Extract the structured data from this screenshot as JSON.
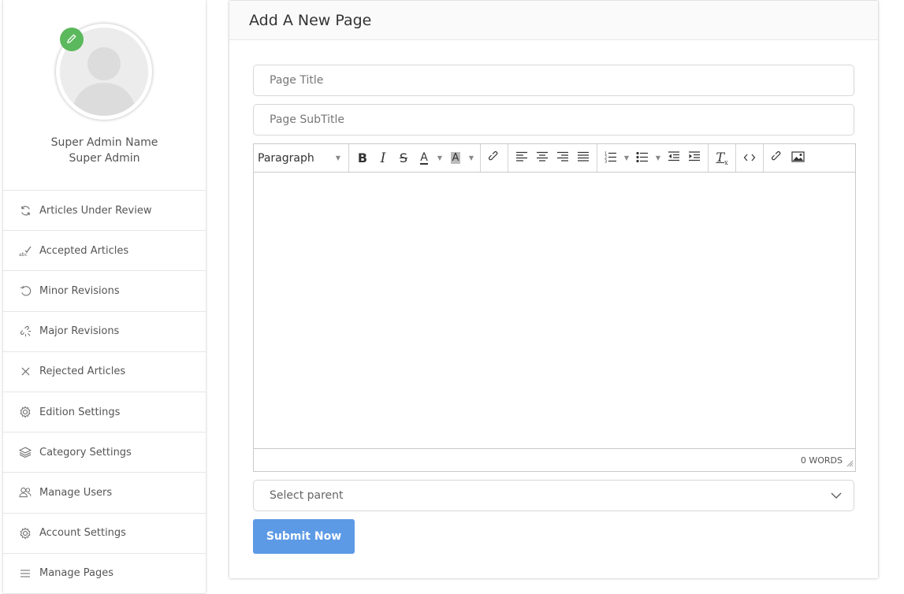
{
  "sidebar": {
    "profile": {
      "name": "Super Admin Name",
      "role": "Super Admin"
    },
    "items": [
      {
        "label": "Articles Under Review",
        "icon": "refresh-icon"
      },
      {
        "label": "Accepted Articles",
        "icon": "spellcheck-icon"
      },
      {
        "label": "Minor Revisions",
        "icon": "undo-icon"
      },
      {
        "label": "Major Revisions",
        "icon": "broken-link-icon"
      },
      {
        "label": "Rejected Articles",
        "icon": "close-icon"
      },
      {
        "label": "Edition Settings",
        "icon": "gear-icon"
      },
      {
        "label": "Category Settings",
        "icon": "layers-icon"
      },
      {
        "label": "Manage Users",
        "icon": "users-icon"
      },
      {
        "label": "Account Settings",
        "icon": "gear-icon"
      },
      {
        "label": "Manage Pages",
        "icon": "menu-icon"
      }
    ]
  },
  "main": {
    "title": "Add A New Page",
    "page_title_placeholder": "Page Title",
    "page_subtitle_placeholder": "Page SubTitle",
    "editor": {
      "format": "Paragraph",
      "word_count": "0 WORDS"
    },
    "select_parent": "Select parent",
    "submit_label": "Submit Now"
  },
  "colors": {
    "accent": "#5d9ae6",
    "edit_badge": "#5cb85c"
  }
}
